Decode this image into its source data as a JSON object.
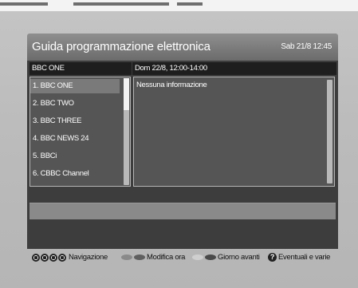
{
  "header": {
    "title": "Guida programmazione elettronica",
    "datetime": "Sab 21/8 12:45"
  },
  "channel_header": "BBC ONE",
  "event_header": "Dom 22/8, 12:00-14:00",
  "channels": [
    {
      "label": "1. BBC ONE",
      "selected": true
    },
    {
      "label": "2. BBC TWO",
      "selected": false
    },
    {
      "label": "3. BBC THREE",
      "selected": false
    },
    {
      "label": "4. BBC NEWS 24",
      "selected": false
    },
    {
      "label": "5. BBCi",
      "selected": false
    },
    {
      "label": "6. CBBC Channel",
      "selected": false
    }
  ],
  "event_info": "Nessuna informazione",
  "footer": {
    "nav_label": "Navigazione",
    "red_label": "Modifica ora",
    "green_label": "Giorno avanti",
    "help_label": "Eventuali e varie",
    "help_glyph": "?",
    "colors": {
      "red": "#8a8a8a",
      "green": "#5f5f5f",
      "yellow": "#cfcfcf",
      "blue": "#4a4a4a"
    }
  },
  "icons": {
    "nav": [
      "left-arrow-icon",
      "up-arrow-icon",
      "down-arrow-icon",
      "right-arrow-icon"
    ],
    "help": "help-icon"
  }
}
